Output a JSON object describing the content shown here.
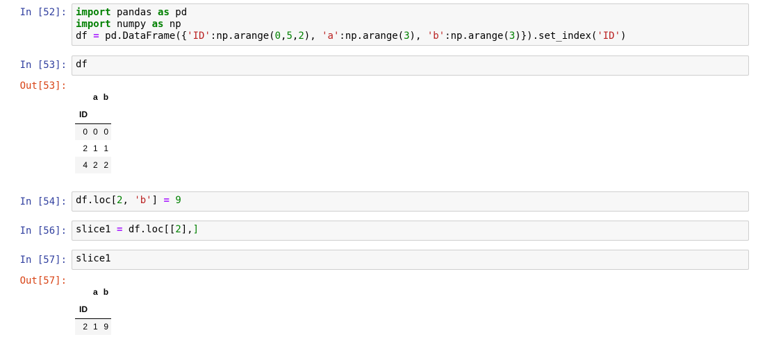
{
  "cells": {
    "c52": {
      "prompt": "In [52]:",
      "lines": [
        [
          {
            "t": "import",
            "c": "kw"
          },
          {
            "t": " pandas ",
            "c": ""
          },
          {
            "t": "as",
            "c": "kw"
          },
          {
            "t": " pd",
            "c": ""
          }
        ],
        [
          {
            "t": "import",
            "c": "kw"
          },
          {
            "t": " numpy ",
            "c": ""
          },
          {
            "t": "as",
            "c": "kw"
          },
          {
            "t": " np",
            "c": ""
          }
        ],
        [
          {
            "t": "df ",
            "c": ""
          },
          {
            "t": "=",
            "c": "op"
          },
          {
            "t": " pd.DataFrame({",
            "c": ""
          },
          {
            "t": "'ID'",
            "c": "str"
          },
          {
            "t": ":np.arange(",
            "c": ""
          },
          {
            "t": "0",
            "c": "num"
          },
          {
            "t": ",",
            "c": ""
          },
          {
            "t": "5",
            "c": "num"
          },
          {
            "t": ",",
            "c": ""
          },
          {
            "t": "2",
            "c": "num"
          },
          {
            "t": "), ",
            "c": ""
          },
          {
            "t": "'a'",
            "c": "str"
          },
          {
            "t": ":np.arange(",
            "c": ""
          },
          {
            "t": "3",
            "c": "num"
          },
          {
            "t": "), ",
            "c": ""
          },
          {
            "t": "'b'",
            "c": "str"
          },
          {
            "t": ":np.arange(",
            "c": ""
          },
          {
            "t": "3",
            "c": "num"
          },
          {
            "t": ")}).set_index(",
            "c": ""
          },
          {
            "t": "'ID'",
            "c": "str"
          },
          {
            "t": ")",
            "c": ""
          }
        ]
      ]
    },
    "c53": {
      "prompt": "In [53]:",
      "lines": [
        [
          {
            "t": "df",
            "c": ""
          }
        ]
      ],
      "out_prompt": "Out[53]:",
      "table": {
        "columns": [
          "a",
          "b"
        ],
        "index_name": "ID",
        "rows": [
          {
            "index": "0",
            "values": [
              "0",
              "0"
            ]
          },
          {
            "index": "2",
            "values": [
              "1",
              "1"
            ]
          },
          {
            "index": "4",
            "values": [
              "2",
              "2"
            ]
          }
        ]
      }
    },
    "c54": {
      "prompt": "In [54]:",
      "lines": [
        [
          {
            "t": "df.loc[",
            "c": ""
          },
          {
            "t": "2",
            "c": "num"
          },
          {
            "t": ", ",
            "c": ""
          },
          {
            "t": "'b'",
            "c": "str"
          },
          {
            "t": "] ",
            "c": ""
          },
          {
            "t": "=",
            "c": "op"
          },
          {
            "t": " ",
            "c": ""
          },
          {
            "t": "9",
            "c": "num"
          }
        ]
      ]
    },
    "c56": {
      "prompt": "In [56]:",
      "lines": [
        [
          {
            "t": "slice1 ",
            "c": ""
          },
          {
            "t": "=",
            "c": "op"
          },
          {
            "t": " df.loc[[",
            "c": ""
          },
          {
            "t": "2",
            "c": "num"
          },
          {
            "t": "],",
            "c": ""
          },
          {
            "t": "]",
            "c": "br"
          }
        ]
      ]
    },
    "c57": {
      "prompt": "In [57]:",
      "lines": [
        [
          {
            "t": "slice1",
            "c": ""
          }
        ]
      ],
      "out_prompt": "Out[57]:",
      "table": {
        "columns": [
          "a",
          "b"
        ],
        "index_name": "ID",
        "rows": [
          {
            "index": "2",
            "values": [
              "1",
              "9"
            ]
          }
        ]
      }
    }
  }
}
